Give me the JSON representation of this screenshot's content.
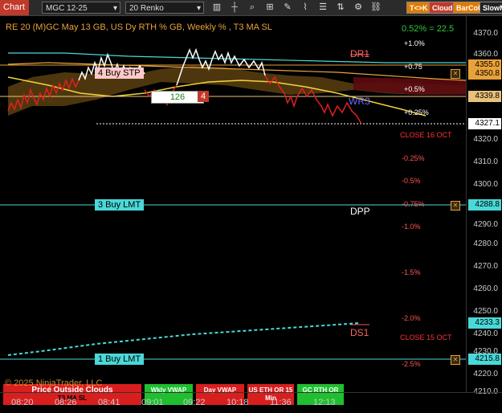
{
  "toolbar": {
    "tab": "Chart",
    "instrument": "MGC 12-25",
    "bar_type": "20 Renko",
    "icons": [
      "bar-style-icon",
      "crosshair-icon",
      "zoom-icon",
      "data-box-icon",
      "drawing-tools-icon",
      "indicators-icon",
      "strategies-icon",
      "flip-icon",
      "properties-icon",
      "attach-icon"
    ],
    "badges": [
      {
        "label": "T<>K",
        "color": "#e07b00"
      },
      {
        "label": "Cloud",
        "color": "#c0392b"
      },
      {
        "label": "BarCol",
        "color": "#e07b00"
      },
      {
        "label": "SlowM",
        "color": "#222222"
      }
    ]
  },
  "header": {
    "title": "RE 20  (M)GC May 13 GB, US Dy RTH % GB, Weekly % , T3 MA SL",
    "change": "0.52% = 22.5"
  },
  "price_axis": {
    "ticks": [
      "4370.0",
      "4360.0",
      "4320.0",
      "4310.0",
      "4300.0",
      "4290.0",
      "4280.0",
      "4270.0",
      "4260.0",
      "4250.0",
      "4240.0",
      "4230.0",
      "4220.0",
      "4210.0"
    ],
    "tags": [
      {
        "label": "4355.0",
        "color": "#e8a23a"
      },
      {
        "label": "4350.8",
        "color": "#e8a23a"
      },
      {
        "label": "4339.8",
        "color": "#e8c27a"
      },
      {
        "label": "4327.1",
        "color": "#ffffff"
      },
      {
        "label": "4288.8",
        "color": "#4ad8d8"
      },
      {
        "label": "4233.3",
        "color": "#4ad8d8"
      },
      {
        "label": "4215.8",
        "color": "#4ad8d8"
      }
    ]
  },
  "percent_labels": [
    {
      "label": "+1.0%",
      "color": "#ffffff"
    },
    {
      "label": "+0.75",
      "color": "#ffffff"
    },
    {
      "label": "+0.5%",
      "color": "#ffffff"
    },
    {
      "label": "+0.25%",
      "color": "#ffffff"
    },
    {
      "label": "-0.25%",
      "color": "#ff5555"
    },
    {
      "label": "-0.5%",
      "color": "#ff5555"
    },
    {
      "label": "-0.75%",
      "color": "#ff5555"
    },
    {
      "label": "-1.0%",
      "color": "#ff5555"
    },
    {
      "label": "-1.5%",
      "color": "#ff5555"
    },
    {
      "label": "-2.0%",
      "color": "#ff5555"
    },
    {
      "label": "-2.5%",
      "color": "#ff5555"
    }
  ],
  "levels": {
    "dr1": "DR1",
    "wr3": "WR3",
    "dpp": "DPP",
    "ds1": "DS1",
    "close_16": "CLOSE 16 OCT",
    "close_15": "CLOSE 15 OCT"
  },
  "orders": {
    "buy_stp": "4 Buy STP",
    "qty_box": "126",
    "qty_count": "4",
    "buy_lmt_3": "3 Buy LMT",
    "buy_lmt_1": "1 Buy LMT"
  },
  "status_buttons": [
    {
      "label": "Price Outside Clouds",
      "color": "#d91e1e"
    },
    {
      "label": "Wkly VWAP",
      "color": "#1fbf2f"
    },
    {
      "label": "Day VWAP",
      "color": "#d91e1e"
    },
    {
      "label": "US ETH OR 15 Min",
      "color": "#d91e1e"
    },
    {
      "label": "GC RTH OR",
      "color": "#1fbf2f"
    }
  ],
  "status_sub": "T3 MA SL",
  "copyright": "© 2025 NinjaTrader, LLC",
  "time_axis": [
    "08:20",
    "08:26",
    "08:41",
    "09:01",
    "09:22",
    "10:18",
    "11:36",
    "12:13"
  ]
}
